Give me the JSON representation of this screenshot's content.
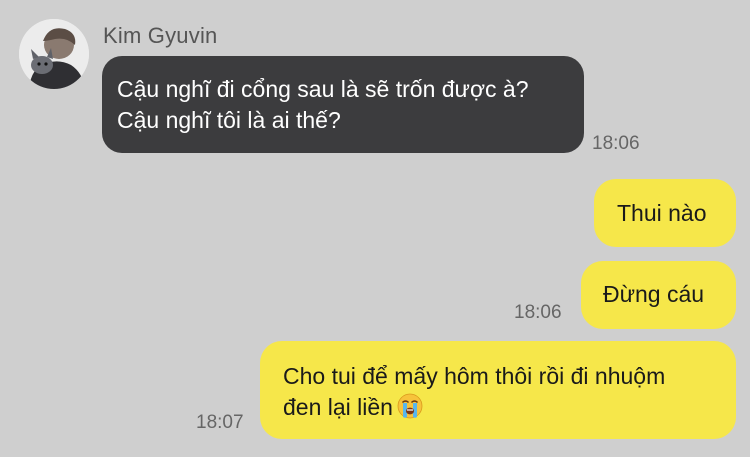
{
  "chat": {
    "sender": {
      "name": "Kim Gyuvin"
    },
    "messages": [
      {
        "direction": "incoming",
        "lines": [
          "Cậu nghĩ đi cổng sau là sẽ trốn được à?",
          "Cậu nghĩ tôi là ai thế?"
        ],
        "time": "18:06"
      },
      {
        "direction": "outgoing",
        "lines": [
          "Thui nào"
        ]
      },
      {
        "direction": "outgoing",
        "lines": [
          "Đừng cáu"
        ],
        "time": "18:06"
      },
      {
        "direction": "outgoing",
        "lines": [
          "Cho tui để mấy hôm thôi rồi đi nhuộm",
          "đen lại liền"
        ],
        "emoji": "loudly-crying-face-icon",
        "time": "18:07"
      }
    ]
  },
  "colors": {
    "background": "#cfcfcf",
    "incoming_bubble": "#3c3c3e",
    "outgoing_bubble": "#f6e74a"
  }
}
